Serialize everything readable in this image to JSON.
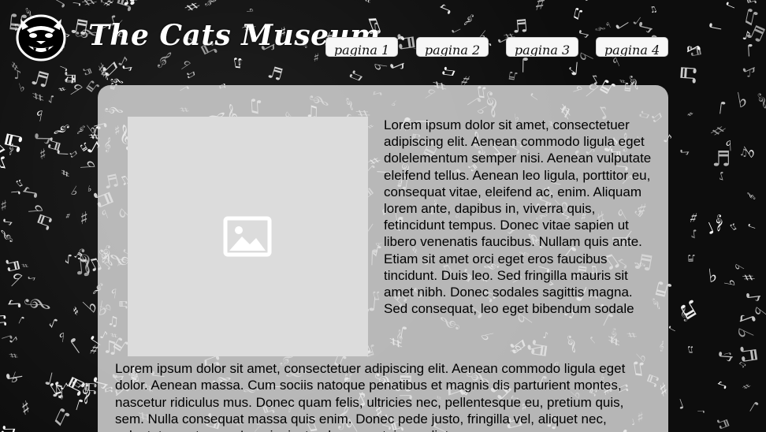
{
  "site": {
    "title": "The Cats Museum"
  },
  "nav": {
    "items": [
      {
        "label": "pagina 1"
      },
      {
        "label": "pagina 2"
      },
      {
        "label": "pagina 3"
      },
      {
        "label": "pagina 4"
      }
    ]
  },
  "content": {
    "side_text": "Lorem ipsum dolor sit amet, consectetuer adipiscing elit. Aenean commodo ligula eget dolelementum semper nisi. Aenean vulputate eleifend tellus. Aenean leo ligula, porttitor eu, consequat vitae, eleifend ac, enim. Aliquam lorem ante, dapibus in, viverra quis, fetincidunt tempus. Donec vitae sapien ut libero venenatis faucibus. Nullam quis ante. Etiam sit amet orci eget eros faucibus tincidunt. Duis leo. Sed fringilla mauris sit amet nibh. Donec sodales sagittis magna. Sed consequat, leo eget bibendum sodale",
    "bottom_text": "Lorem ipsum dolor sit amet, consectetuer adipiscing elit. Aenean commodo ligula eget dolor. Aenean massa. Cum sociis natoque penatibus et magnis dis parturient montes, nascetur ridiculus mus. Donec quam felis, ultricies nec, pellentesque eu, pretium quis, sem. Nulla consequat massa quis enim. Donec pede justo, fringilla vel, aliquet nec, vulputate eget, arcu. In enim justo, rhoncus ut, imperdiet a"
  },
  "icons": {
    "logo": "panther-head-logo",
    "image_placeholder": "image-icon"
  },
  "colors": {
    "background": "#0d0d0d",
    "panel": "#e1e1e1",
    "nav_button": "#f7f7f7",
    "title": "#ffffff"
  }
}
